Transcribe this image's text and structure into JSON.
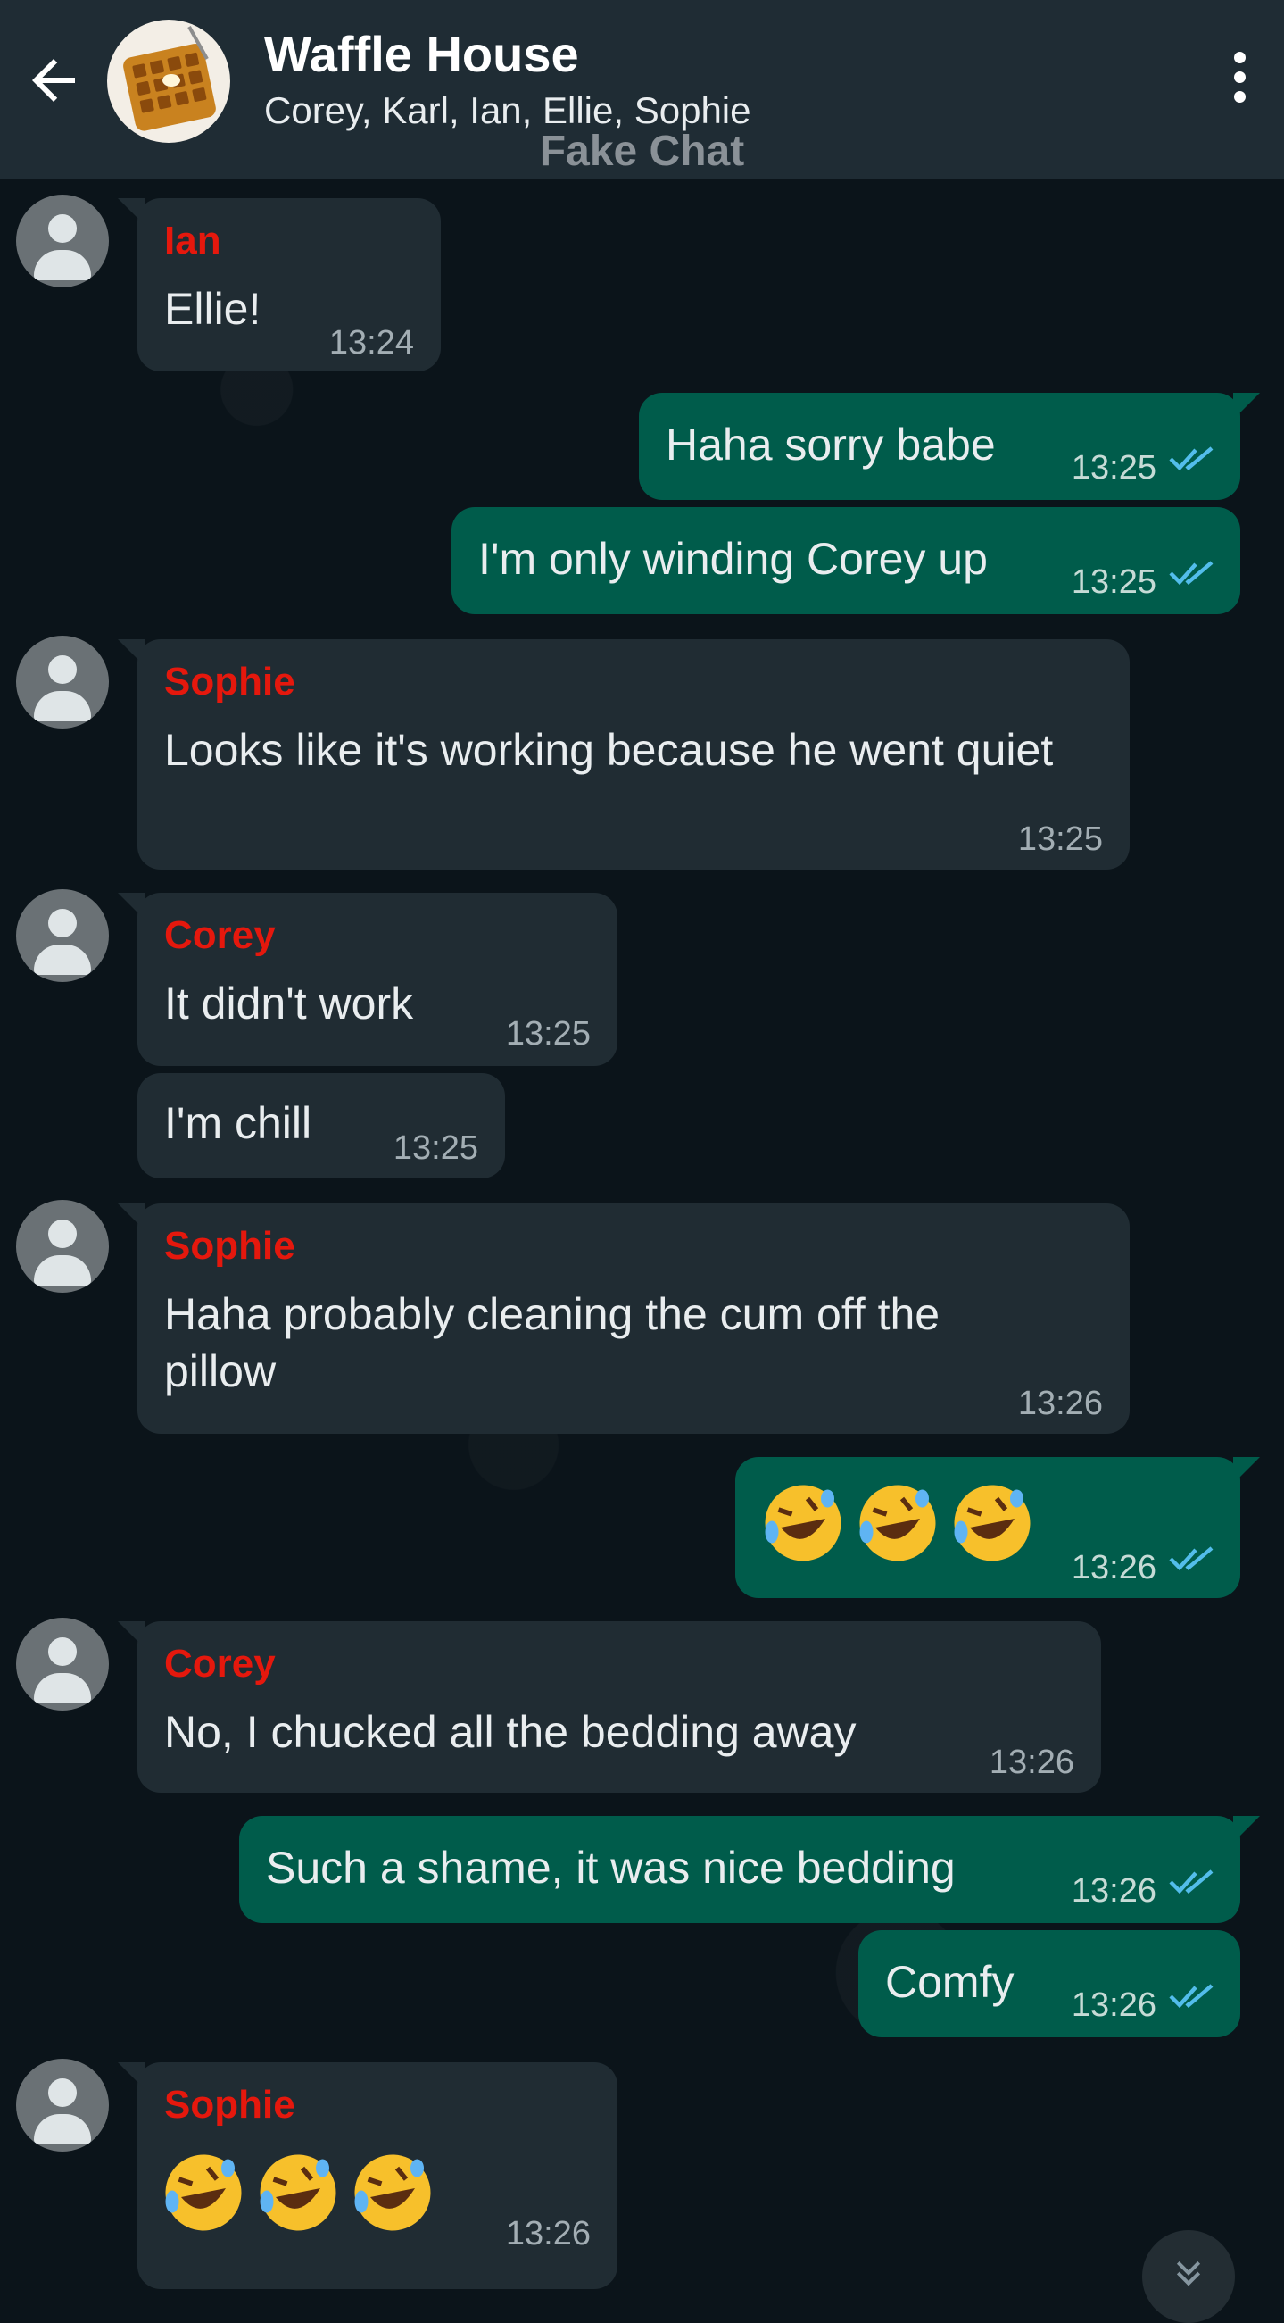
{
  "header": {
    "title": "Waffle House",
    "participants": "Corey, Karl, Ian, Ellie, Sophie",
    "watermark": "Fake Chat"
  },
  "messages": [
    {
      "sender": "Ian",
      "text": "Ellie!",
      "time": "13:24"
    },
    {
      "text": "Haha sorry babe",
      "time": "13:25"
    },
    {
      "text": "I'm only winding Corey up",
      "time": "13:25"
    },
    {
      "sender": "Sophie",
      "text": "Looks like it's working because he went quiet",
      "time": "13:25"
    },
    {
      "sender": "Corey",
      "text": "It didn't work",
      "time": "13:25"
    },
    {
      "text": "I'm chill",
      "time": "13:25"
    },
    {
      "sender": "Sophie",
      "text": "Haha probably cleaning the cum off the pillow",
      "time": "13:26"
    },
    {
      "emoji": "rolling-on-floor-laughing x3",
      "time": "13:26"
    },
    {
      "sender": "Corey",
      "text": "No, I chucked all the bedding away",
      "time": "13:26"
    },
    {
      "text": "Such a shame, it was nice bedding",
      "time": "13:26"
    },
    {
      "text": "Comfy",
      "time": "13:26"
    },
    {
      "sender": "Sophie",
      "emoji": "rolling-on-floor-laughing x3",
      "time": "13:26"
    }
  ],
  "colors": {
    "header_bg": "#1f2c34",
    "chat_bg": "#0b141a",
    "incoming_bubble": "#202c33",
    "outgoing_bubble": "#005c4b",
    "sender_name": "#e5180d",
    "read_ticks": "#53bdeb"
  },
  "icons": [
    "back-arrow-icon",
    "more-vertical-icon",
    "double-check-icon",
    "default-avatar-icon",
    "scroll-down-icon"
  ]
}
